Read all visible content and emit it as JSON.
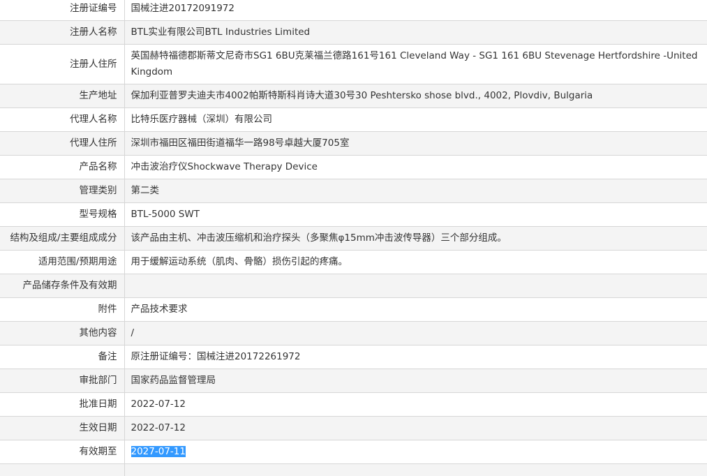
{
  "rows": [
    {
      "label": "注册证编号",
      "value": "国械注进20172091972"
    },
    {
      "label": "注册人名称",
      "value": "BTL实业有限公司BTL Industries Limited"
    },
    {
      "label": "注册人住所",
      "value": "英国赫特福德郡斯蒂文尼奇市SG1 6BU克莱福兰德路161号161 Cleveland Way - SG1 161 6BU Stevenage Hertfordshire -United Kingdom"
    },
    {
      "label": "生产地址",
      "value": "保加利亚普罗夫迪夫市4002帕斯特斯科肖诗大道30号30 Peshtersko shose blvd., 4002, Plovdiv, Bulgaria"
    },
    {
      "label": "代理人名称",
      "value": "比特乐医疗器械（深圳）有限公司"
    },
    {
      "label": "代理人住所",
      "value": "深圳市福田区福田街道福华一路98号卓越大厦705室"
    },
    {
      "label": "产品名称",
      "value": "冲击波治疗仪Shockwave Therapy Device"
    },
    {
      "label": "管理类别",
      "value": "第二类"
    },
    {
      "label": "型号规格",
      "value": "BTL-5000 SWT"
    },
    {
      "label": "结构及组成/主要组成成分",
      "value": "该产品由主机、冲击波压缩机和治疗探头（多聚焦φ15mm冲击波传导器）三个部分组成。"
    },
    {
      "label": "适用范围/预期用途",
      "value": "用于缓解运动系统（肌肉、骨骼）损伤引起的疼痛。"
    },
    {
      "label": "产品储存条件及有效期",
      "value": ""
    },
    {
      "label": "附件",
      "value": "产品技术要求"
    },
    {
      "label": "其他内容",
      "value": "/"
    },
    {
      "label": "备注",
      "value": "原注册证编号：国械注进20172261972"
    },
    {
      "label": "审批部门",
      "value": "国家药品监督管理局"
    },
    {
      "label": "批准日期",
      "value": "2022-07-12"
    },
    {
      "label": "生效日期",
      "value": "2022-07-12"
    },
    {
      "label": "有效期至",
      "value": "2027-07-11"
    },
    {
      "label": "",
      "value": ""
    }
  ]
}
